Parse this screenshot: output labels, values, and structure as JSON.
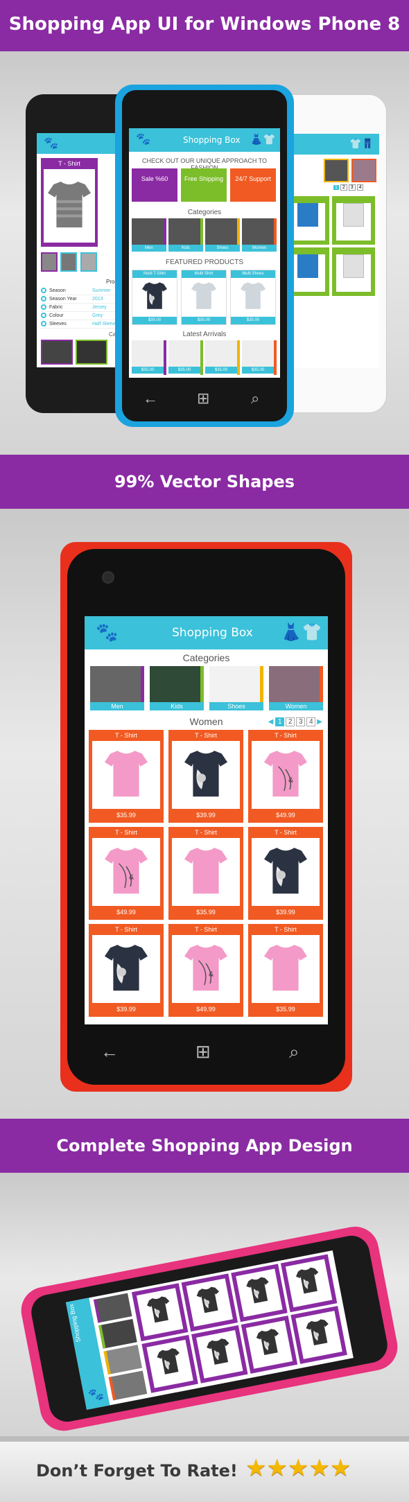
{
  "banners": {
    "top": "Shopping App UI for Windows Phone 8",
    "vector": "99% Vector Shapes",
    "complete": "Complete Shopping App Design",
    "rate": "Don’t Forget To Rate!"
  },
  "app": {
    "title": "Shopping Box",
    "tagline": "CHECK OUT OUR UNIQUE APPROACH TO FASHION",
    "promos": [
      {
        "label": "Sale %60",
        "color": "#8a2ba3"
      },
      {
        "label": "Free Shipping",
        "color": "#7cbd2a"
      },
      {
        "label": "24/7 Support",
        "color": "#f15a22"
      }
    ],
    "categories_heading": "Categories",
    "categories": [
      {
        "label": "Men",
        "color": "#8a2ba3"
      },
      {
        "label": "Kids",
        "color": "#7cbd2a"
      },
      {
        "label": "Shoes",
        "color": "#f0b400"
      },
      {
        "label": "Women",
        "color": "#f15a22"
      }
    ],
    "featured_heading": "FEATURED PRODUCTS",
    "featured": [
      {
        "name": "Multi T-Shirt",
        "price": "$35.00"
      },
      {
        "name": "Multi Shirt",
        "price": "$35.00"
      },
      {
        "name": "Multi Shoes",
        "price": "$35.00"
      }
    ],
    "latest_heading": "Latest Arrivals",
    "latest_prices": [
      "$35.00",
      "$35.00",
      "$35.00",
      "$35.00"
    ]
  },
  "detail": {
    "header_title": "T - Shirt",
    "product_detail_heading": "Product D",
    "attributes": [
      {
        "key": "Season",
        "value": "Summer"
      },
      {
        "key": "Season Year",
        "value": "2013"
      },
      {
        "key": "Fabric",
        "value": "Jersey"
      },
      {
        "key": "Colour",
        "value": "Grey"
      },
      {
        "key": "Sleeves",
        "value": "Half Sleeves"
      }
    ],
    "categories_heading": "Categ"
  },
  "kids_pages": [
    "1",
    "2",
    "3",
    "4"
  ],
  "women_screen": {
    "title": "Shopping Box",
    "categories_heading": "Categories",
    "categories": [
      "Men",
      "Kids",
      "Shoes",
      "Women"
    ],
    "section": "Women",
    "pages": [
      "1",
      "2",
      "3",
      "4"
    ],
    "products": [
      {
        "name": "T - Shirt",
        "price": "$35.99",
        "tee": "pink"
      },
      {
        "name": "T - Shirt",
        "price": "$39.99",
        "tee": "navy"
      },
      {
        "name": "T - Shirt",
        "price": "$49.99",
        "tee": "pinkprint"
      },
      {
        "name": "T - Shirt",
        "price": "$49.99",
        "tee": "pinkprint"
      },
      {
        "name": "T - Shirt",
        "price": "$35.99",
        "tee": "pink"
      },
      {
        "name": "T - Shirt",
        "price": "$39.99",
        "tee": "navy"
      },
      {
        "name": "T - Shirt",
        "price": "$39.99",
        "tee": "navy"
      },
      {
        "name": "T - Shirt",
        "price": "$49.99",
        "tee": "pinkprint"
      },
      {
        "name": "T - Shirt",
        "price": "$35.99",
        "tee": "pink"
      }
    ]
  },
  "tilted_screen": {
    "title": "Shopping Box",
    "categories_heading": "Categories"
  },
  "colors": {
    "accent": "#3bc1d9",
    "purple": "#8a2ba3",
    "orange": "#f15a22",
    "green": "#7cbd2a",
    "red_phone": "#e8301c",
    "pink_phone": "#e8337d"
  },
  "rating": {
    "stars": 5
  }
}
